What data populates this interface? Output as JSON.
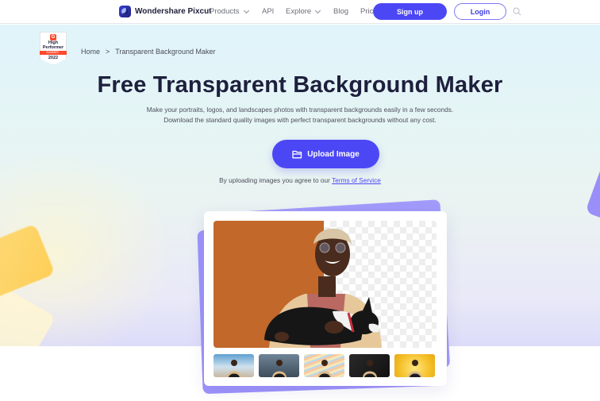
{
  "header": {
    "brand": "Wondershare Pixcut",
    "nav": [
      {
        "label": "Products",
        "has_dropdown": true
      },
      {
        "label": "API",
        "has_dropdown": false
      },
      {
        "label": "Explore",
        "has_dropdown": true
      },
      {
        "label": "Blog",
        "has_dropdown": false
      },
      {
        "label": "Pricing",
        "has_dropdown": false
      }
    ],
    "signup_label": "Sign up",
    "login_label": "Login",
    "search_icon": "search-icon"
  },
  "badge": {
    "logo": "G",
    "line1": "High",
    "line2": "Performer",
    "season": "SUMMER",
    "year": "2022"
  },
  "breadcrumb": {
    "home": "Home",
    "separator": ">",
    "current": "Transparent Background Maker"
  },
  "hero": {
    "title": "Free Transparent Background Maker",
    "subtitle_line1": "Make your portraits, logos, and landscapes photos with transparent backgrounds easily in a few seconds.",
    "subtitle_line2": "Download the standard quality images with perfect transparent backgrounds without any cost.",
    "upload_label": "Upload Image",
    "upload_icon": "folder-icon",
    "terms_prefix": "By uploading images you agree to our ",
    "terms_link": "Terms of Service"
  },
  "showcase": {
    "main_image": "man-holding-dog-split-orange-and-transparent",
    "thumbnails": [
      {
        "name": "beach-background"
      },
      {
        "name": "city-background"
      },
      {
        "name": "wavy-lines-background"
      },
      {
        "name": "dark-background"
      },
      {
        "name": "yellow-burst-background"
      }
    ]
  },
  "colors": {
    "accent": "#4c47f5",
    "title": "#1e1f3d",
    "orange_backdrop": "#c1682a",
    "deco_purple": "#9d93fb",
    "deco_yellow": "#ffcb4a"
  }
}
